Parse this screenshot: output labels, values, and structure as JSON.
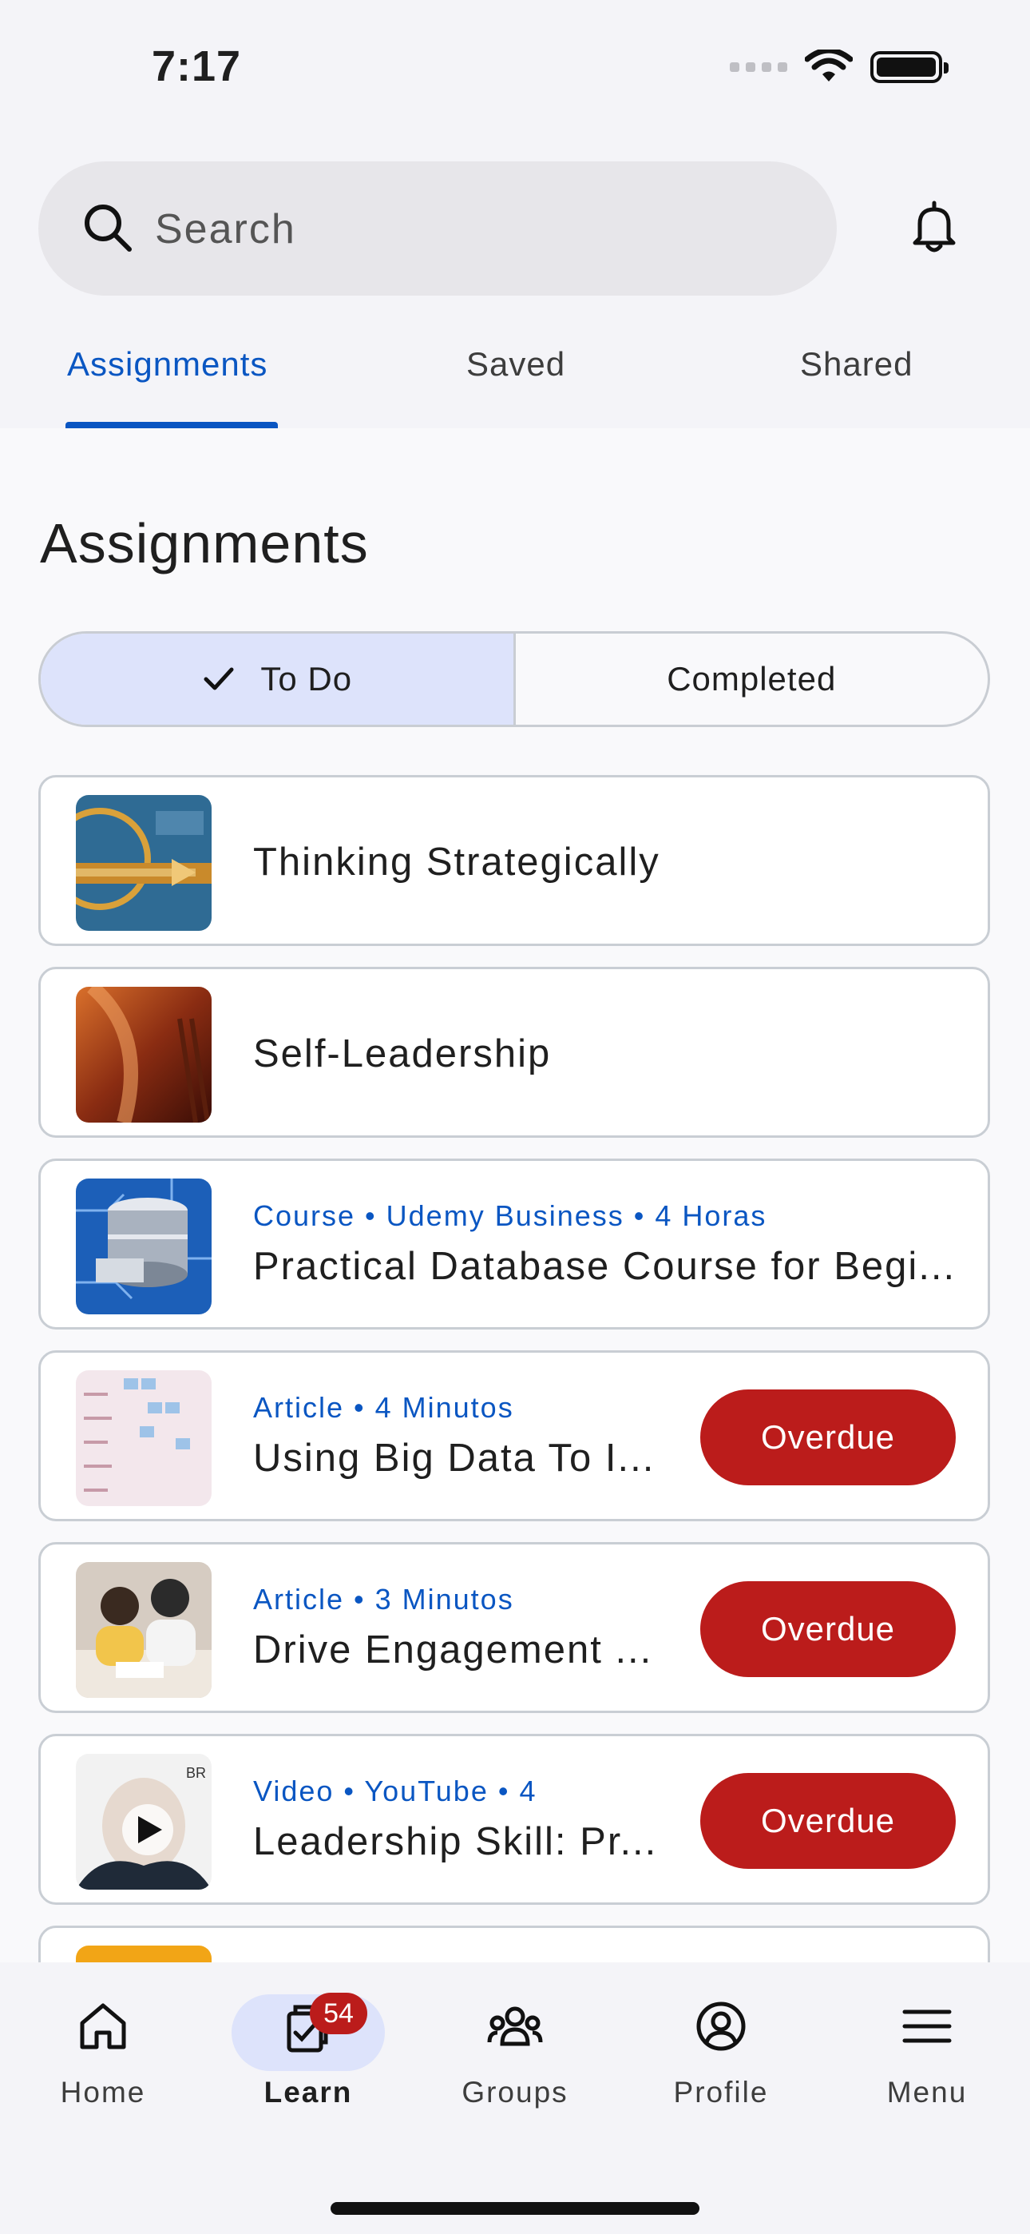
{
  "status_bar": {
    "time": "7:17"
  },
  "search": {
    "placeholder": "Search"
  },
  "tabs": [
    {
      "label": "Assignments",
      "active": true
    },
    {
      "label": "Saved",
      "active": false
    },
    {
      "label": "Shared",
      "active": false
    }
  ],
  "page_title": "Assignments",
  "segment": {
    "todo": "To Do",
    "completed": "Completed",
    "selected": "todo"
  },
  "assignments": [
    {
      "meta": "",
      "title": "Thinking Strategically",
      "status": ""
    },
    {
      "meta": "",
      "title": "Self-Leadership",
      "status": ""
    },
    {
      "meta": "Course • Udemy Business • 4 Horas",
      "title": "Practical Database Course for Begi...",
      "status": ""
    },
    {
      "meta": "Article • 4 Minutos",
      "title": "Using Big Data To I...",
      "status": "Overdue"
    },
    {
      "meta": "Article • 3 Minutos",
      "title": "Drive Engagement ...",
      "status": "Overdue"
    },
    {
      "meta": "Video • YouTube • 4",
      "title": "Leadership Skill: Pr...",
      "status": "Overdue"
    }
  ],
  "bottom_nav": {
    "items": [
      {
        "label": "Home",
        "icon": "home-icon"
      },
      {
        "label": "Learn",
        "icon": "learn-icon",
        "badge": "54",
        "active": true
      },
      {
        "label": "Groups",
        "icon": "groups-icon"
      },
      {
        "label": "Profile",
        "icon": "profile-icon"
      },
      {
        "label": "Menu",
        "icon": "menu-icon"
      }
    ]
  },
  "colors": {
    "accent": "#0a56c2",
    "overdue": "#bb1c1b",
    "selected_bg": "#dde3fb"
  }
}
